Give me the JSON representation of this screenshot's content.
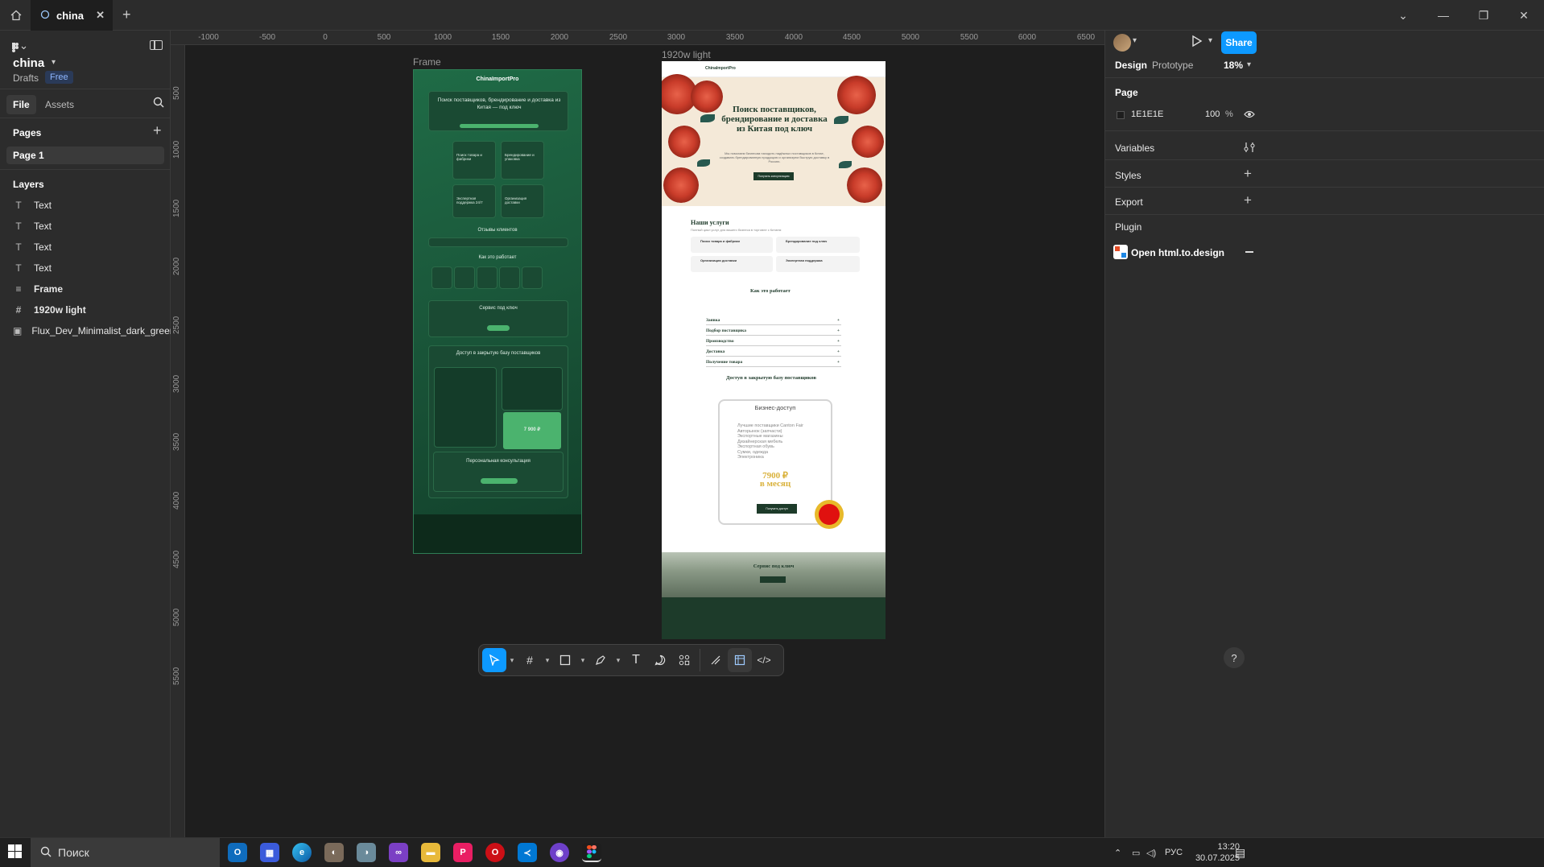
{
  "titlebar": {
    "tab_title": "china",
    "close": "✕",
    "add": "+"
  },
  "file": {
    "name": "china",
    "location": "Drafts",
    "plan": "Free"
  },
  "left_tabs": {
    "file": "File",
    "assets": "Assets"
  },
  "pages": {
    "title": "Pages",
    "items": [
      "Page 1"
    ]
  },
  "layers": {
    "title": "Layers",
    "items": [
      {
        "icon": "T",
        "name": "Text"
      },
      {
        "icon": "T",
        "name": "Text"
      },
      {
        "icon": "T",
        "name": "Text"
      },
      {
        "icon": "T",
        "name": "Text"
      },
      {
        "icon": "≡",
        "name": "Frame"
      },
      {
        "icon": "#",
        "name": "1920w light"
      },
      {
        "icon": "▣",
        "name": "Flux_Dev_Minimalist_dark_green_abstract_"
      }
    ]
  },
  "ruler_top": [
    "-1000",
    "-500",
    "0",
    "500",
    "1000",
    "1500",
    "2000",
    "2500",
    "3000",
    "3500",
    "4000",
    "4500",
    "5000",
    "5500",
    "6000",
    "6500"
  ],
  "ruler_left": [
    "500",
    "1000",
    "1500",
    "2000",
    "2500",
    "3000",
    "3500",
    "4000",
    "4500",
    "5000",
    "5500"
  ],
  "canvas": {
    "frame_label": "Frame",
    "light_label": "1920w light",
    "dark": {
      "brand": "ChinaImportPro",
      "hero": "Поиск поставщиков, брендирование и доставка из Китая — под ключ",
      "card1": "Поиск товара и фабрики",
      "card2": "Брендирование и упаковка",
      "card3": "Экспертная поддержка 24/7",
      "card4": "Организация доставки",
      "reviews": "Отзывы клиентов",
      "how": "Как это работает",
      "turnkey": "Сервис под ключ",
      "access": "Доступ в закрытую базу поставщиков",
      "price": "7 900 ₽",
      "consult": "Персональная консультация"
    },
    "light": {
      "brand": "ChinaImportPro",
      "hero": "Поиск поставщиков, брендирование и доставка из Китая под ключ",
      "hero_sub": "Мы помогаем бизнесам находить надёжных поставщиков в Китае, создавать брендированную продукцию и организуем быструю доставку в Россию.",
      "hero_btn": "Получить консультацию",
      "services_title": "Наши услуги",
      "services_sub": "Полный цикл услуг для вашего бизнеса в торговле с Китаем",
      "svc1": "Поиск товара и фабрики",
      "svc2": "Брендирование под ключ",
      "svc3": "Организация доставки",
      "svc4": "Экспертная поддержка",
      "how_title": "Как это работает",
      "steps": [
        "Заявка",
        "Подбор поставщика",
        "Производство",
        "Доставка",
        "Получение товара"
      ],
      "base_title": "Доступ в закрытую базу поставщиков",
      "card_title": "Бизнес-доступ",
      "card_list": [
        "Лучшие поставщики Canton Fair",
        "Авторынок (запчасти)",
        "Экспортные магазины",
        "Дизайнерская мебель",
        "Экспортная обувь",
        "Сумки, одежда",
        "Электроника"
      ],
      "card_price": "7900 ₽",
      "card_period": "в месяц",
      "card_btn": "Получить доступ",
      "turnkey": "Сервис под ключ"
    }
  },
  "right_panel": {
    "tabs": {
      "design": "Design",
      "prototype": "Prototype"
    },
    "zoom": "18%",
    "share": "Share",
    "page_title": "Page",
    "page_color": "1E1E1E",
    "page_opacity": "100",
    "percent": "%",
    "variables": "Variables",
    "styles": "Styles",
    "export": "Export",
    "plugin_title": "Plugin",
    "plugin_name": "Open html.to.design"
  },
  "help": "?",
  "taskbar": {
    "search": "Поиск",
    "lang": "РУС",
    "time": "13:20",
    "date": "30.07.2025"
  },
  "colors": {
    "accent": "#0d99ff",
    "canvas": "#1E1E1E",
    "panel": "#2c2c2c"
  }
}
